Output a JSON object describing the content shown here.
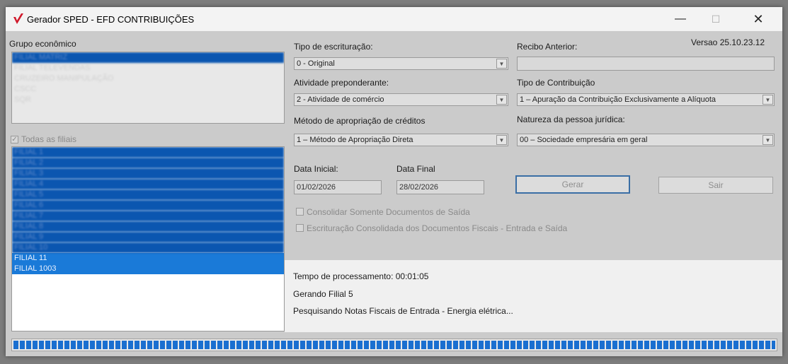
{
  "window": {
    "title": "Gerador SPED - EFD CONTRIBUIÇÕES",
    "controls": {
      "minimize": "—",
      "maximize": "☐",
      "close": "✕"
    }
  },
  "version": "Versao 25.10.23.12",
  "left": {
    "group_label": "Grupo econômico",
    "groups": [
      "FILIAL MATRIZ",
      "FILIAL TELEVENDAS",
      "CRUZEIRO MANIPULAÇÃO",
      "CSCC",
      "SQR"
    ],
    "all_branches_label": "Todas as filiais",
    "branches": [
      "FILIAL 1",
      "FILIAL 2",
      "FILIAL 3",
      "FILIAL 4",
      "FILIAL 5",
      "FILIAL 6",
      "FILIAL 7",
      "FILIAL 8",
      "FILIAL 9",
      "FILIAL 10",
      "FILIAL 11",
      "FILIAL 1003"
    ]
  },
  "form": {
    "tipo_escrituracao": {
      "label": "Tipo de escrituração:",
      "value": "0 - Original"
    },
    "recibo_anterior": {
      "label": "Recibo Anterior:",
      "value": ""
    },
    "atividade": {
      "label": "Atividade preponderante:",
      "value": "2 - Atividade de comércio"
    },
    "tipo_contribuicao": {
      "label": "Tipo de Contribuição",
      "value": "1 – Apuração da Contribuição Exclusivamente a Alíquota"
    },
    "metodo": {
      "label": "Método de apropriação de créditos",
      "value": "1 – Método de Apropriação Direta"
    },
    "natureza": {
      "label": "Natureza da pessoa jurídica:",
      "value": "00 – Sociedade empresária em geral"
    },
    "data_inicial": {
      "label": "Data Inicial:",
      "value": "01/02/2026"
    },
    "data_final": {
      "label": "Data Final",
      "value": "28/02/2026"
    },
    "gerar": "Gerar",
    "sair": "Sair",
    "chk_consolidar": "Consolidar Somente Documentos de Saída",
    "chk_escrituracao": "Escrituração Consolidada dos Documentos Fiscais - Entrada e Saída"
  },
  "status": {
    "tempo": "Tempo de processamento: 00:01:05",
    "gerando": "Gerando Filial 5",
    "pesquisando": "Pesquisando Notas Fiscais de Entrada - Energia elétrica..."
  },
  "progress": {
    "value": 100
  },
  "colors": {
    "accent": "#1a6fd0",
    "selection": "#0b56b0",
    "logo": "#d0182a"
  }
}
